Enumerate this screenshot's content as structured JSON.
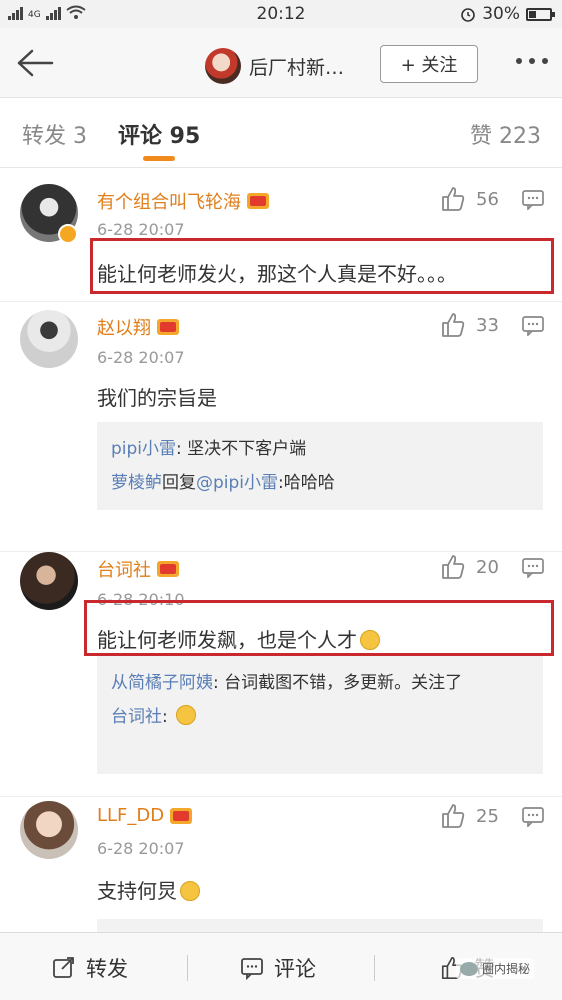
{
  "status_bar": {
    "network": "4G",
    "time": "20:12",
    "battery": "30%"
  },
  "header": {
    "title": "后厂村新…",
    "follow_label": "+ 关注"
  },
  "tabs": [
    {
      "label": "转发 3"
    },
    {
      "label": "评论 95"
    },
    {
      "label": "赞 223"
    }
  ],
  "comments": [
    {
      "name": "有个组合叫飞轮海",
      "time": "6-28 20:07",
      "text": "能让何老师发火，那这个人真是不好。。。",
      "likes": "56"
    },
    {
      "name": "赵以翔",
      "time": "6-28 20:07",
      "text": "我们的宗旨是",
      "likes": "33",
      "replies": [
        {
          "name": "pipi小雷",
          "sep": ": ",
          "text": "坚决不下客户端"
        },
        {
          "name": "萝棱鲈",
          "mid": "回复",
          "at": "@pipi小雷",
          "text": ":哈哈哈"
        }
      ]
    },
    {
      "name": "台词社",
      "time": "6-28 20:10",
      "text": "能让何老师发飙，也是个人才",
      "likes": "20",
      "replies": [
        {
          "name": "从简橘子阿姨",
          "sep": ": ",
          "text": "台词截图不错，多更新。关注了"
        },
        {
          "name": "台词社",
          "sep": ": ",
          "text": ""
        }
      ]
    },
    {
      "name": "LLF_DD",
      "time": "6-28 20:07",
      "text": "支持何炅",
      "likes": "25"
    }
  ],
  "bottom_bar": {
    "repost": "转发",
    "comment": "评论",
    "like": "赞"
  },
  "watermark": "圈内揭秘",
  "colors": {
    "accent": "#f08a1d",
    "name": "#e07e1a",
    "link": "#5a7fb5",
    "highlight": "#c9282d"
  }
}
